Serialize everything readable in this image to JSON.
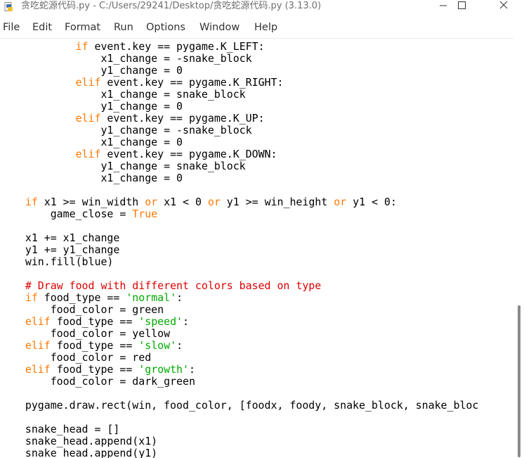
{
  "window": {
    "title": "贪吃蛇源代码.py - C:/Users/29241/Desktop/贪吃蛇源代码.py (3.13.0)"
  },
  "menu": [
    "File",
    "Edit",
    "Format",
    "Run",
    "Options",
    "Window",
    "Help"
  ],
  "colors": {
    "keyword": "#ff7700",
    "string": "#00aa00",
    "comment": "#dd0000",
    "text": "#000000"
  },
  "code_lines": [
    [
      [
        "            ",
        ""
      ],
      [
        "if",
        "kw"
      ],
      [
        " event.key == pygame.K_LEFT:",
        ""
      ]
    ],
    [
      [
        "                x1_change = -snake_block",
        ""
      ]
    ],
    [
      [
        "                y1_change = 0",
        ""
      ]
    ],
    [
      [
        "            ",
        ""
      ],
      [
        "elif",
        "kw"
      ],
      [
        " event.key == pygame.K_RIGHT:",
        ""
      ]
    ],
    [
      [
        "                x1_change = snake_block",
        ""
      ]
    ],
    [
      [
        "                y1_change = 0",
        ""
      ]
    ],
    [
      [
        "            ",
        ""
      ],
      [
        "elif",
        "kw"
      ],
      [
        " event.key == pygame.K_UP:",
        ""
      ]
    ],
    [
      [
        "                y1_change = -snake_block",
        ""
      ]
    ],
    [
      [
        "                x1_change = 0",
        ""
      ]
    ],
    [
      [
        "            ",
        ""
      ],
      [
        "elif",
        "kw"
      ],
      [
        " event.key == pygame.K_DOWN:",
        ""
      ]
    ],
    [
      [
        "                y1_change = snake_block",
        ""
      ]
    ],
    [
      [
        "                x1_change = 0",
        ""
      ]
    ],
    [],
    [
      [
        "    ",
        ""
      ],
      [
        "if",
        "kw"
      ],
      [
        " x1 >= win_width ",
        ""
      ],
      [
        "or",
        "kw"
      ],
      [
        " x1 < 0 ",
        ""
      ],
      [
        "or",
        "kw"
      ],
      [
        " y1 >= win_height ",
        ""
      ],
      [
        "or",
        "kw"
      ],
      [
        " y1 < 0:",
        ""
      ]
    ],
    [
      [
        "        game_close = ",
        ""
      ],
      [
        "True",
        "kw"
      ]
    ],
    [],
    [
      [
        "    x1 += x1_change",
        ""
      ]
    ],
    [
      [
        "    y1 += y1_change",
        ""
      ]
    ],
    [
      [
        "    win.fill(blue)",
        ""
      ]
    ],
    [],
    [
      [
        "    ",
        ""
      ],
      [
        "# Draw food with different colors based on type",
        "cm"
      ]
    ],
    [
      [
        "    ",
        ""
      ],
      [
        "if",
        "kw"
      ],
      [
        " food_type == ",
        ""
      ],
      [
        "'normal'",
        "str"
      ],
      [
        ":",
        ""
      ]
    ],
    [
      [
        "        food_color = green",
        ""
      ]
    ],
    [
      [
        "    ",
        ""
      ],
      [
        "elif",
        "kw"
      ],
      [
        " food_type == ",
        ""
      ],
      [
        "'speed'",
        "str"
      ],
      [
        ":",
        ""
      ]
    ],
    [
      [
        "        food_color = yellow",
        ""
      ]
    ],
    [
      [
        "    ",
        ""
      ],
      [
        "elif",
        "kw"
      ],
      [
        " food_type == ",
        ""
      ],
      [
        "'slow'",
        "str"
      ],
      [
        ":",
        ""
      ]
    ],
    [
      [
        "        food_color = red",
        ""
      ]
    ],
    [
      [
        "    ",
        ""
      ],
      [
        "elif",
        "kw"
      ],
      [
        " food_type == ",
        ""
      ],
      [
        "'growth'",
        "str"
      ],
      [
        ":",
        ""
      ]
    ],
    [
      [
        "        food_color = dark_green",
        ""
      ]
    ],
    [],
    [
      [
        "    pygame.draw.rect(win, food_color, [foodx, foody, snake_block, snake_bloc",
        ""
      ]
    ],
    [],
    [
      [
        "    snake_head = []",
        ""
      ]
    ],
    [
      [
        "    snake_head.append(x1)",
        ""
      ]
    ],
    [
      [
        "    snake_head.append(y1)",
        ""
      ]
    ]
  ]
}
